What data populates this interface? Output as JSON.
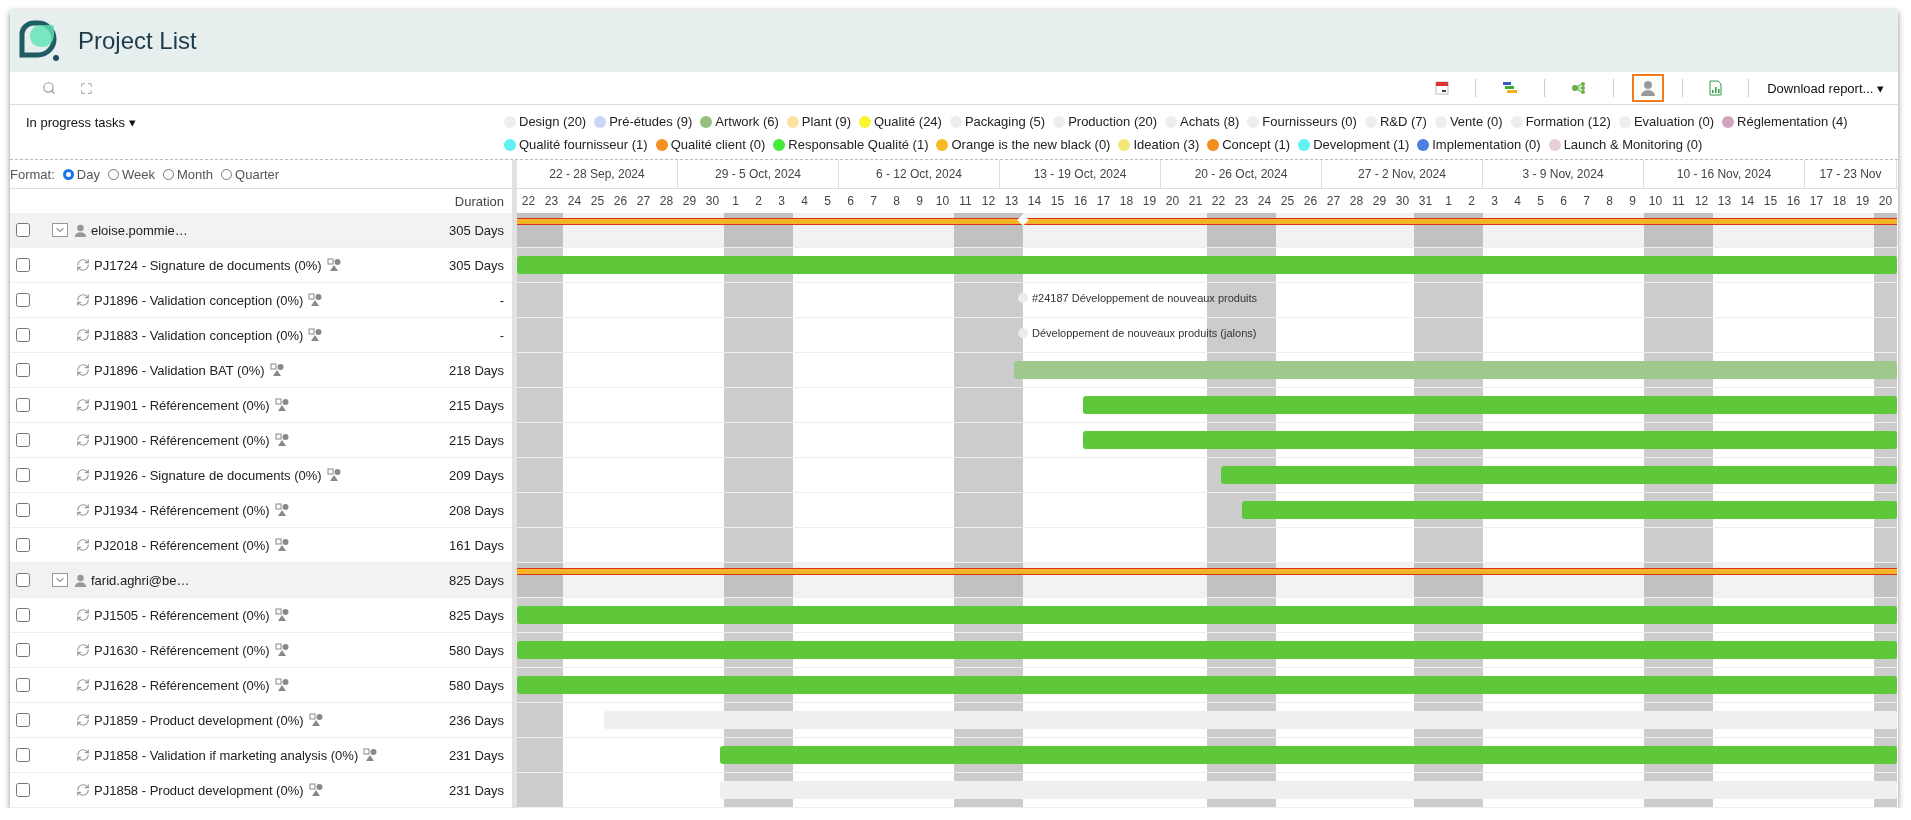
{
  "app": {
    "title": "Project List"
  },
  "view_tools": [
    {
      "kind": "calendar",
      "selected": false
    },
    {
      "kind": "gantt",
      "selected": false
    },
    {
      "kind": "tree",
      "selected": false
    },
    {
      "kind": "resource",
      "selected": true
    },
    {
      "kind": "report",
      "selected": false
    }
  ],
  "download_menu": "Download report... ▾",
  "filter": "In progress tasks ▾",
  "legend": [
    {
      "name": "Design (20)",
      "color": "#eeeeee"
    },
    {
      "name": "Pré-études (9)",
      "color": "#c9d7f4"
    },
    {
      "name": "Artwork (6)",
      "color": "#93c07e"
    },
    {
      "name": "Plant (9)",
      "color": "#fbe1a4"
    },
    {
      "name": "Qualité (24)",
      "color": "#fbf430"
    },
    {
      "name": "Packaging (5)",
      "color": "#eeeeee"
    },
    {
      "name": "Production (20)",
      "color": "#eeeeee"
    },
    {
      "name": "Achats (8)",
      "color": "#eeeeee"
    },
    {
      "name": "Fournisseurs (0)",
      "color": "#eeeeee"
    },
    {
      "name": "R&D (7)",
      "color": "#eeeeee"
    },
    {
      "name": "Vente (0)",
      "color": "#eeeeee"
    },
    {
      "name": "Formation (12)",
      "color": "#eeeeee"
    },
    {
      "name": "Evaluation (0)",
      "color": "#eeeeee"
    },
    {
      "name": "Réglementation (4)",
      "color": "#d1a4c0"
    },
    {
      "name": "Qualité fournisseur (1)",
      "color": "#60f2f2"
    },
    {
      "name": "Qualité client (0)",
      "color": "#f39220"
    },
    {
      "name": "Responsable Qualité (1)",
      "color": "#44ea3a"
    },
    {
      "name": "Orange is the new black (0)",
      "color": "#f6bb22"
    },
    {
      "name": "Ideation (3)",
      "color": "#f3e877"
    },
    {
      "name": "Concept (1)",
      "color": "#f28e1e"
    },
    {
      "name": "Development (1)",
      "color": "#60f2f2"
    },
    {
      "name": "Implementation (0)",
      "color": "#4e7fe2"
    },
    {
      "name": "Launch & Monitoring (0)",
      "color": "#e9cdd9"
    }
  ],
  "format": {
    "label": "Format:",
    "options": [
      {
        "label": "Day",
        "selected": true
      },
      {
        "label": "Week",
        "selected": false
      },
      {
        "label": "Month",
        "selected": false
      },
      {
        "label": "Quarter",
        "selected": false
      }
    ]
  },
  "duration_header": "Duration",
  "timeline": {
    "weeks": [
      {
        "label": "22 - 28 Sep, 2024",
        "days": [
          {
            "label": "22",
            "shaded": true
          },
          {
            "label": "23",
            "shaded": true
          },
          {
            "label": "24",
            "shaded": false
          },
          {
            "label": "25",
            "shaded": false
          },
          {
            "label": "26",
            "shaded": false
          },
          {
            "label": "27",
            "shaded": false
          },
          {
            "label": "28",
            "shaded": false
          }
        ]
      },
      {
        "label": "29 - 5 Oct, 2024",
        "days": [
          {
            "label": "29",
            "shaded": false
          },
          {
            "label": "30",
            "shaded": false
          },
          {
            "label": "1",
            "shaded": true
          },
          {
            "label": "2",
            "shaded": true
          },
          {
            "label": "3",
            "shaded": true
          },
          {
            "label": "4",
            "shaded": false
          },
          {
            "label": "5",
            "shaded": false
          }
        ]
      },
      {
        "label": "6 - 12 Oct, 2024",
        "days": [
          {
            "label": "6",
            "shaded": false
          },
          {
            "label": "7",
            "shaded": false
          },
          {
            "label": "8",
            "shaded": false
          },
          {
            "label": "9",
            "shaded": false
          },
          {
            "label": "10",
            "shaded": false
          },
          {
            "label": "11",
            "shaded": true
          },
          {
            "label": "12",
            "shaded": true
          }
        ]
      },
      {
        "label": "13 - 19 Oct, 2024",
        "days": [
          {
            "label": "13",
            "shaded": true
          },
          {
            "label": "14",
            "shaded": false,
            "milestone": true
          },
          {
            "label": "15",
            "shaded": false
          },
          {
            "label": "16",
            "shaded": false
          },
          {
            "label": "17",
            "shaded": false
          },
          {
            "label": "18",
            "shaded": false
          },
          {
            "label": "19",
            "shaded": false
          }
        ]
      },
      {
        "label": "20 - 26 Oct, 2024",
        "days": [
          {
            "label": "20",
            "shaded": false
          },
          {
            "label": "21",
            "shaded": false
          },
          {
            "label": "22",
            "shaded": true
          },
          {
            "label": "23",
            "shaded": true
          },
          {
            "label": "24",
            "shaded": true
          },
          {
            "label": "25",
            "shaded": false
          },
          {
            "label": "26",
            "shaded": false
          }
        ]
      },
      {
        "label": "27 - 2 Nov, 2024",
        "days": [
          {
            "label": "27",
            "shaded": false
          },
          {
            "label": "28",
            "shaded": false
          },
          {
            "label": "29",
            "shaded": false
          },
          {
            "label": "30",
            "shaded": false
          },
          {
            "label": "31",
            "shaded": true
          },
          {
            "label": "1",
            "shaded": true
          },
          {
            "label": "2",
            "shaded": true
          }
        ]
      },
      {
        "label": "3 - 9 Nov, 2024",
        "days": [
          {
            "label": "3",
            "shaded": false
          },
          {
            "label": "4",
            "shaded": false
          },
          {
            "label": "5",
            "shaded": false
          },
          {
            "label": "6",
            "shaded": false
          },
          {
            "label": "7",
            "shaded": false
          },
          {
            "label": "8",
            "shaded": false
          },
          {
            "label": "9",
            "shaded": false
          }
        ]
      },
      {
        "label": "10 - 16 Nov, 2024",
        "days": [
          {
            "label": "10",
            "shaded": true
          },
          {
            "label": "11",
            "shaded": true
          },
          {
            "label": "12",
            "shaded": true
          },
          {
            "label": "13",
            "shaded": false
          },
          {
            "label": "14",
            "shaded": false
          },
          {
            "label": "15",
            "shaded": false
          },
          {
            "label": "16",
            "shaded": false
          }
        ]
      },
      {
        "label": "17 - 23 Nov",
        "days": [
          {
            "label": "17",
            "shaded": false
          },
          {
            "label": "18",
            "shaded": false
          },
          {
            "label": "19",
            "shaded": false
          },
          {
            "label": "20",
            "shaded": true
          }
        ]
      }
    ]
  },
  "rows": [
    {
      "kind": "group",
      "name": "eloise.pommie…",
      "duration": "305 Days",
      "checked": false,
      "expanded": true,
      "gantt": {
        "kind": "summary",
        "level": 1,
        "marker": true
      }
    },
    {
      "kind": "task",
      "name": "PJ1724 - Signature de documents (0%)",
      "duration": "305 Days",
      "checked": false,
      "gantt": {
        "kind": "bar",
        "level": 1,
        "color": "#5ec73a"
      }
    },
    {
      "kind": "task",
      "name": "PJ1896 - Validation conception (0%)",
      "duration": "-",
      "checked": false,
      "gantt": {
        "kind": "milestone",
        "label": "#24187 Développement de nouveaux produits"
      }
    },
    {
      "kind": "task",
      "name": "PJ1883 - Validation conception (0%)",
      "duration": "-",
      "checked": false,
      "gantt": {
        "kind": "milestone",
        "label": "Développement de nouveaux produits (jalons)"
      }
    },
    {
      "kind": "task",
      "name": "PJ1896 - Validation BAT (0%)",
      "duration": "218 Days",
      "checked": false,
      "gantt": {
        "kind": "bar",
        "level": 0.64,
        "color": "#9fc88c"
      }
    },
    {
      "kind": "task",
      "name": "PJ1901 - Référencement (0%)",
      "duration": "215 Days",
      "checked": false,
      "gantt": {
        "kind": "bar",
        "level": 0.59,
        "color": "#5ec73a"
      }
    },
    {
      "kind": "task",
      "name": "PJ1900 - Référencement (0%)",
      "duration": "215 Days",
      "checked": false,
      "gantt": {
        "kind": "bar",
        "level": 0.59,
        "color": "#5ec73a"
      }
    },
    {
      "kind": "task",
      "name": "PJ1926 - Signature de documents (0%)",
      "duration": "209 Days",
      "checked": false,
      "gantt": {
        "kind": "bar",
        "level": 0.49,
        "color": "#5ec73a"
      }
    },
    {
      "kind": "task",
      "name": "PJ1934 - Référencement (0%)",
      "duration": "208 Days",
      "checked": false,
      "gantt": {
        "kind": "bar",
        "level": 0.475,
        "color": "#5ec73a"
      }
    },
    {
      "kind": "task",
      "name": "PJ2018 - Référencement (0%)",
      "duration": "161 Days",
      "checked": false
    },
    {
      "kind": "group",
      "name": "farid.aghri@be…",
      "duration": "825 Days",
      "checked": false,
      "expanded": true,
      "gantt": {
        "kind": "summary",
        "level": 1
      }
    },
    {
      "kind": "task",
      "name": "PJ1505 - Référencement (0%)",
      "duration": "825 Days",
      "checked": false,
      "gantt": {
        "kind": "bar",
        "level": 1,
        "color": "#5ec73a"
      }
    },
    {
      "kind": "task",
      "name": "PJ1630 - Référencement (0%)",
      "duration": "580 Days",
      "checked": false,
      "gantt": {
        "kind": "bar",
        "level": 1,
        "color": "#5ec73a"
      }
    },
    {
      "kind": "task",
      "name": "PJ1628 - Référencement (0%)",
      "duration": "580 Days",
      "checked": false,
      "gantt": {
        "kind": "bar",
        "level": 1,
        "color": "#5ec73a"
      }
    },
    {
      "kind": "task",
      "name": "PJ1859 - Product development (0%)",
      "duration": "236 Days",
      "checked": false,
      "gantt": {
        "kind": "bar",
        "level": 0.937,
        "color": "#efefef"
      }
    },
    {
      "kind": "task",
      "name": "PJ1858 - Validation if marketing analysis (0%)",
      "duration": "231 Days",
      "checked": false,
      "gantt": {
        "kind": "bar",
        "level": 0.853,
        "color": "#5ec73a"
      }
    },
    {
      "kind": "task",
      "name": "PJ1858 - Product development (0%)",
      "duration": "231 Days",
      "checked": false,
      "gantt": {
        "kind": "bar",
        "level": 0.853,
        "color": "#efefef"
      }
    }
  ]
}
